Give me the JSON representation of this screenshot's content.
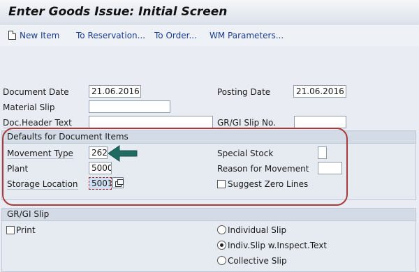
{
  "window": {
    "title": "Enter Goods Issue: Initial Screen"
  },
  "toolbar": {
    "new_item": "New Item",
    "to_reservation": "To Reservation...",
    "to_order": "To Order...",
    "wm_parameters": "WM Parameters..."
  },
  "header": {
    "document_date_label": "Document Date",
    "document_date_value": "21.06.2016",
    "posting_date_label": "Posting Date",
    "posting_date_value": "21.06.2016",
    "material_slip_label": "Material Slip",
    "material_slip_value": "",
    "doc_header_text_label": "Doc.Header Text",
    "doc_header_text_value": "",
    "grgi_slip_no_label": "GR/GI Slip No.",
    "grgi_slip_no_value": ""
  },
  "defaults": {
    "title": "Defaults for Document Items",
    "movement_type_label": "Movement Type",
    "movement_type_value": "262",
    "plant_label": "Plant",
    "plant_value": "5000",
    "storage_location_label": "Storage Location",
    "storage_location_value": "5001",
    "special_stock_label": "Special Stock",
    "special_stock_value": "",
    "reason_label": "Reason for Movement",
    "reason_value": "",
    "suggest_zero_lines_label": "Suggest Zero Lines",
    "suggest_zero_lines_checked": false
  },
  "grgi_slip": {
    "title": "GR/GI Slip",
    "print_label": "Print",
    "print_checked": false,
    "options": [
      "Individual Slip",
      "Indiv.Slip w.Inspect.Text",
      "Collective Slip"
    ],
    "selected": "Indiv.Slip w.Inspect.Text"
  },
  "colors": {
    "annotation": "#a83a3a",
    "arrow": "#1f6b62",
    "link": "#1b3d8c"
  },
  "icons": [
    "new-item-icon",
    "value-help-icon",
    "annotation-arrow-icon"
  ]
}
